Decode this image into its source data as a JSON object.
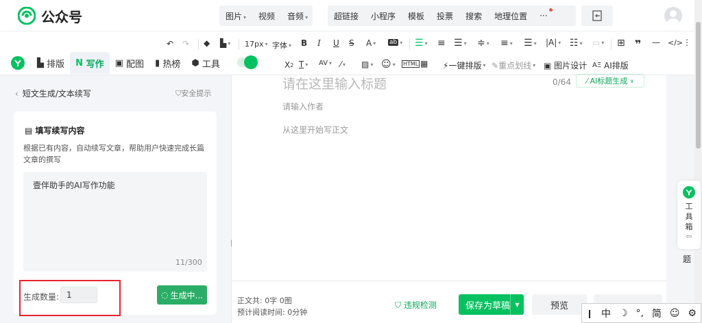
{
  "app": {
    "brand": "公众号"
  },
  "nav": {
    "group1": [
      {
        "label": "图片",
        "dropdown": true
      },
      {
        "label": "视频",
        "dropdown": false
      },
      {
        "label": "音频",
        "dropdown": true
      }
    ],
    "group2": [
      {
        "label": "超链接"
      },
      {
        "label": "小程序"
      },
      {
        "label": "模板"
      },
      {
        "label": "投票"
      },
      {
        "label": "搜索"
      },
      {
        "label": "地理位置"
      },
      {
        "label": "···"
      }
    ]
  },
  "toolbar": {
    "font_size": "17px",
    "font_family": "字体",
    "tabs": [
      {
        "label": "排版"
      },
      {
        "label": "写作"
      },
      {
        "label": "配图"
      },
      {
        "label": "热榜"
      },
      {
        "label": "工具"
      }
    ],
    "one_click_layout": "一键排版",
    "key_line": "重点划线",
    "image_design": "图片设计",
    "ai_layout": "AI排版"
  },
  "left": {
    "breadcrumb_parent": "短文生成",
    "breadcrumb_current": "/文本续写",
    "safety": "安全提示",
    "card_title": "填写续写内容",
    "card_desc": "根据已有内容，自动续写文章，帮助用户快速完成长篇文章的撰写",
    "input_text": "壹伴助手的AI写作功能",
    "char_count": "11/300",
    "qty_label": "生成数量:",
    "qty_value": "1",
    "generate_label": "生成中..."
  },
  "editor": {
    "title_placeholder": "请在这里输入标题",
    "title_count": "0/64",
    "ai_title": "AI标题生成",
    "author_placeholder": "请输入作者",
    "body_placeholder": "从这里开始写正文"
  },
  "bottom": {
    "stats_line1": "正文共:  0字 0图",
    "stats_line2": "预计阅读时间:  0分钟",
    "violation": "违规检测",
    "save": "保存为草稿",
    "preview": "预览"
  },
  "right": {
    "toolbox": "工具箱",
    "ti": "题"
  },
  "ime": {
    "items": [
      "中",
      "☽",
      "°,",
      "简",
      "☺",
      "⚙"
    ]
  },
  "colors": {
    "accent": "#07c160",
    "highlight": "#e8222f"
  }
}
